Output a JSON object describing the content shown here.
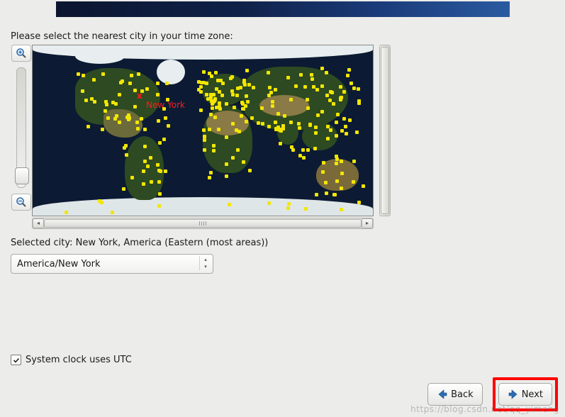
{
  "prompt": "Please select the nearest city in your time zone:",
  "map": {
    "selected_marker": "x",
    "selected_label": "New York"
  },
  "selected_line": "Selected city: New York, America (Eastern (most areas))",
  "timezone_combo": {
    "value": "America/New York"
  },
  "utc_checkbox": {
    "checked": true,
    "label": "System clock uses UTC"
  },
  "buttons": {
    "back": "Back",
    "next": "Next"
  },
  "watermark": "https://blog.csdn.net/qq_yimeng",
  "icons": {
    "zoom_in": "zoom-in-icon",
    "zoom_out": "zoom-out-icon",
    "arrow_left": "arrow-left-icon",
    "arrow_right": "arrow-right-icon",
    "check": "check-icon"
  },
  "colors": {
    "highlight": "#ff0000",
    "city_dot": "#f2e600",
    "ocean": "#0c1b33"
  }
}
